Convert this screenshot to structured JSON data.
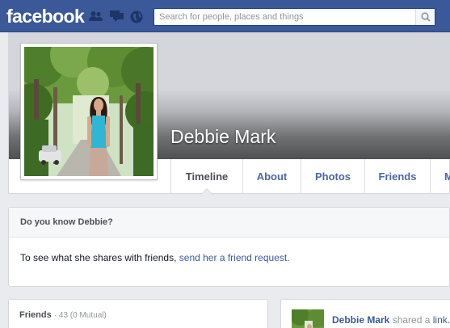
{
  "topbar": {
    "logo": "facebook",
    "search_placeholder": "Search for people, places and things",
    "icons": [
      "friend-requests-icon",
      "messages-icon",
      "notifications-globe-icon",
      "search-icon"
    ],
    "colors": {
      "bar": "#3b5998",
      "link": "#3b5998"
    }
  },
  "profile": {
    "name": "Debbie Mark",
    "picture": "profile-photo-woman-in-park"
  },
  "tabs": [
    {
      "label": "Timeline",
      "active": true
    },
    {
      "label": "About"
    },
    {
      "label": "Photos"
    },
    {
      "label": "Friends"
    },
    {
      "label": "M"
    }
  ],
  "know_card": {
    "title": "Do you know Debbie?",
    "body_text": "To see what she shares with friends,",
    "link_text": "send her a friend request."
  },
  "friends_card": {
    "title": "Friends",
    "count": "· 43 (0 Mutual)"
  },
  "story": {
    "author": "Debbie Mark",
    "action": "shared a",
    "link": "link."
  }
}
